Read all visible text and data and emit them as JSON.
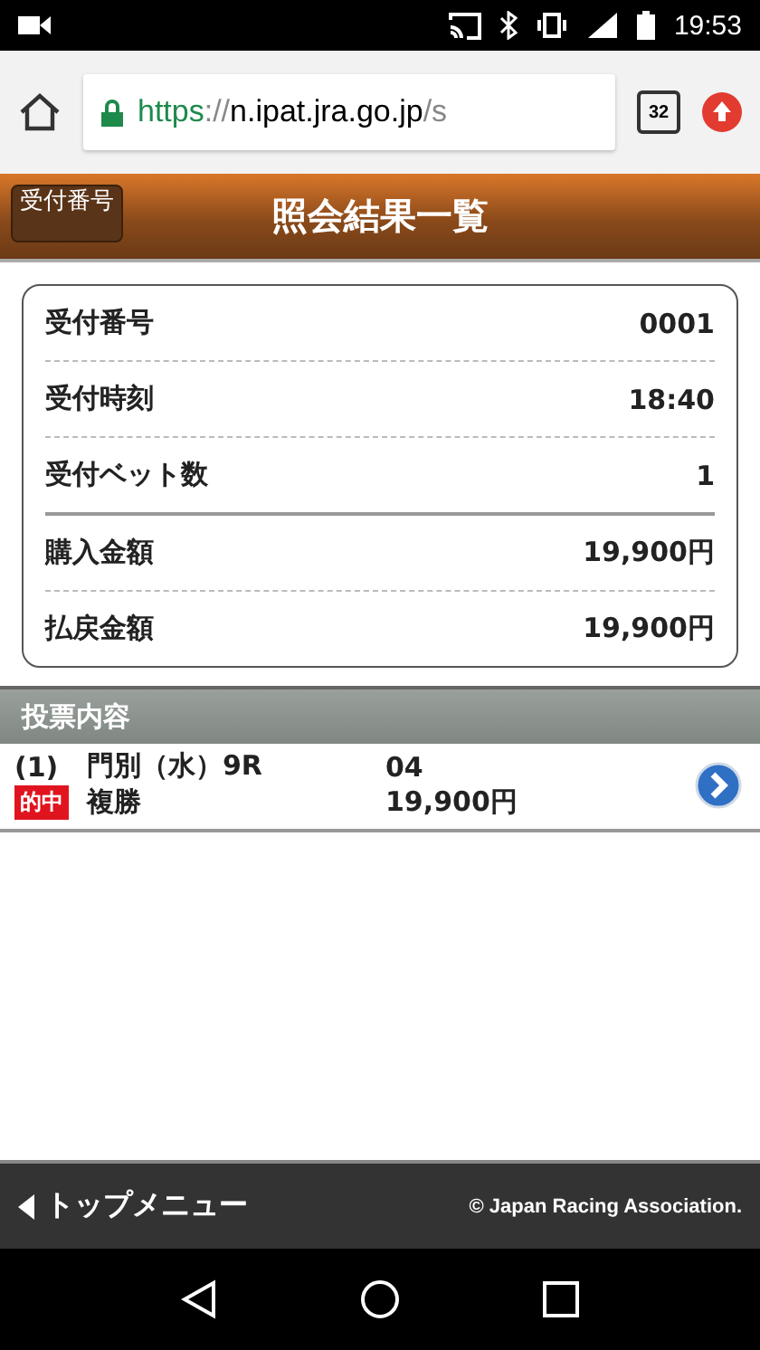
{
  "status_bar": {
    "time": "19:53"
  },
  "browser": {
    "url": {
      "scheme": "https",
      "separator": "://",
      "host": "n.ipat.jra.go.jp",
      "path": "/s"
    },
    "tab_count": "32"
  },
  "header": {
    "back_button": "受付番号",
    "title": "照会結果一覧"
  },
  "summary": {
    "groups": [
      [
        {
          "label": "受付番号",
          "value": "0001"
        },
        {
          "label": "受付時刻",
          "value": "18:40"
        },
        {
          "label": "受付ベット数",
          "value": "1"
        }
      ],
      [
        {
          "label": "購入金額",
          "value": "19,900円"
        },
        {
          "label": "払戻金額",
          "value": "19,900円"
        }
      ]
    ]
  },
  "section": {
    "title": "投票内容"
  },
  "bets": [
    {
      "index": "(1)",
      "race": "門別（水）9R",
      "selection": "04",
      "hit": true,
      "hit_label": "的中",
      "bet_type": "複勝",
      "amount": "19,900円"
    }
  ],
  "footer": {
    "top_menu": "トップメニュー",
    "copyright": "© Japan Racing Association."
  }
}
